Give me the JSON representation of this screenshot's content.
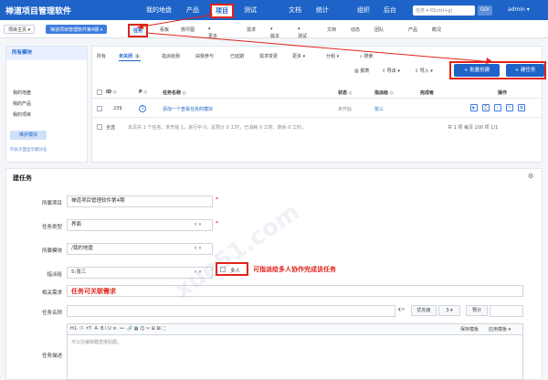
{
  "app": {
    "title": "禅道项目管理软件"
  },
  "main_nav": [
    "我的地盘",
    "产品",
    "项目",
    "测试",
    "文档",
    "统计",
    "组织",
    "后台"
  ],
  "main_nav_active": "项目",
  "top_search": {
    "scope": "任务",
    "placeholder": "ID(ctrl+g)",
    "go": "GO!"
  },
  "user": "admin",
  "breadcrumbs": {
    "home": "项目主页",
    "project": "禅道项目管理软件第4期"
  },
  "sub_nav": [
    "任务",
    "看板",
    "燃尽图",
    "更多",
    "需求",
    "版本",
    "测试",
    "文档",
    "动态",
    "团队",
    "产品",
    "概况"
  ],
  "sub_nav_active": "任务",
  "sidebar": {
    "header": "所有模块",
    "items": [
      "我的地盘",
      "我的产品",
      "我的项目"
    ],
    "maintain_button": "维护模块",
    "link": "列表页面显示模块名"
  },
  "filter_tabs": {
    "items": [
      {
        "label": "所有",
        "count": ""
      },
      {
        "label": "未关闭",
        "count": "1"
      },
      {
        "label": "指派给我",
        "count": ""
      },
      {
        "label": "由我参与",
        "count": ""
      },
      {
        "label": "已延期",
        "count": ""
      },
      {
        "label": "需求变更",
        "count": ""
      },
      {
        "label": "更多",
        "count": ""
      },
      {
        "label": "分组",
        "count": ""
      },
      {
        "label": "搜索",
        "count": ""
      }
    ],
    "active": "未关闭"
  },
  "toolbar": {
    "report": "报表",
    "export": "导出",
    "import": "导入",
    "batch_create": "+ 批量创建",
    "create_task": "+ 建任务"
  },
  "table": {
    "headers": [
      "ID",
      "P",
      "任务名称",
      "状态",
      "指派给",
      "完成者",
      "操作"
    ],
    "rows": [
      {
        "id": "239",
        "pri": "3",
        "name": "添加一个查看任务的模块",
        "status": "未开始",
        "assigned": "张三",
        "finished": ""
      }
    ],
    "footer": {
      "select_all": "全选",
      "summary": "本页共 1 个任务，未开始 1，进行中 0，总预计 0 工时，已消耗 0 工时，剩余 0 工时。",
      "pagination": "共 1 项  每页 100 项  1/1"
    }
  },
  "form": {
    "title": "建任务",
    "fields": {
      "project": {
        "label": "所属项目",
        "value": "禅道项目管理软件第4期"
      },
      "type": {
        "label": "任务类型",
        "value": "界面"
      },
      "module": {
        "label": "所属模块",
        "value": "/我的地盘"
      },
      "assigned": {
        "label": "指派给",
        "value": "S:张三",
        "multi": "多人"
      },
      "story": {
        "label": "相关需求",
        "value": ""
      },
      "name": {
        "label": "任务名称",
        "value": ""
      },
      "priority": {
        "label": "优先级",
        "value": "3"
      },
      "estimate": {
        "label": "预计",
        "value": ""
      },
      "desc": {
        "label": "任务描述",
        "placeholder": "可以在编辑器直接贴图。",
        "save_template": "保存模板",
        "apply_template": "应用模板"
      }
    },
    "editor_toolbar": "H1·  ℱ·  τT·  A·  B  I  U  ≡·  ≔·  🔗  ▦  ☺  ✂  ⊞  ⊠  ⛶"
  },
  "annotations": {
    "assign_multi": "可指派给多人协作完成该任务",
    "story_link": "任务可关联需求"
  },
  "watermark": "xue51.com"
}
